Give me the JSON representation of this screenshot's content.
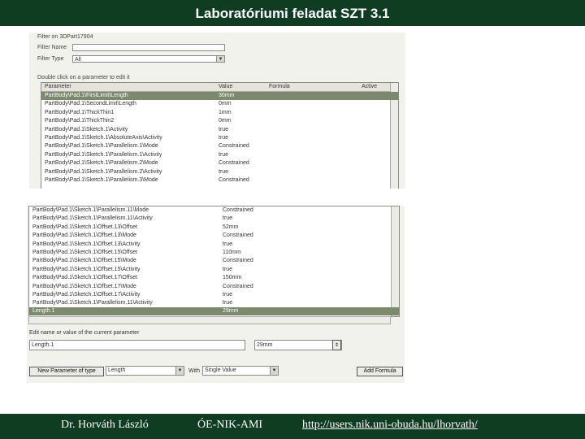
{
  "slide": {
    "title": "Laboratóriumi feladat SZT 3.1",
    "footer_author": "Dr. Horváth László",
    "footer_dept": "ÓE-NIK-AMI",
    "footer_url": "http://users.nik.uni-obuda.hu/lhorvath/"
  },
  "filters": {
    "filter_on_label": "Filter on 3DPart17904",
    "name_label": "Filter Name",
    "type_label": "Filter Type",
    "name_value": "",
    "type_value": "All"
  },
  "table": {
    "caption": "Double click on a parameter to edit it",
    "col_parameter": "Parameter",
    "col_value": "Value",
    "col_formula": "Formula",
    "col_active": "Active",
    "rows_top": [
      {
        "p": "PartBody\\Pad.1\\FirstLimit\\Length",
        "v": "30mm"
      },
      {
        "p": "PartBody\\Pad.1\\SecondLimit\\Length",
        "v": "0mm"
      },
      {
        "p": "PartBody\\Pad.1\\ThickThin1",
        "v": "1mm"
      },
      {
        "p": "PartBody\\Pad.1\\ThickThin2",
        "v": "0mm"
      },
      {
        "p": "PartBody\\Pad.1\\Sketch.1\\Activity",
        "v": "true"
      },
      {
        "p": "PartBody\\Pad.1\\Sketch.1\\AbsoluteAxis\\Activity",
        "v": "true"
      },
      {
        "p": "PartBody\\Pad.1\\Sketch.1\\Parallelism.1\\Mode",
        "v": "Constrained"
      },
      {
        "p": "PartBody\\Pad.1\\Sketch.1\\Parallelism.1\\Activity",
        "v": "true"
      },
      {
        "p": "PartBody\\Pad.1\\Sketch.1\\Parallelism.2\\Mode",
        "v": "Constrained"
      },
      {
        "p": "PartBody\\Pad.1\\Sketch.1\\Parallelism.2\\Activity",
        "v": "true"
      },
      {
        "p": "PartBody\\Pad.1\\Sketch.1\\Parallelism.3\\Mode",
        "v": "Constrained"
      }
    ],
    "rows_bottom": [
      {
        "p": "PartBody\\Pad.1\\Sketch.1\\Parallelism.11\\Mode",
        "v": "Constrained"
      },
      {
        "p": "PartBody\\Pad.1\\Sketch.1\\Parallelism.11\\Activity",
        "v": "true"
      },
      {
        "p": "PartBody\\Pad.1\\Sketch.1\\Offset.13\\Offset",
        "v": "52mm"
      },
      {
        "p": "PartBody\\Pad.1\\Sketch.1\\Offset.13\\Mode",
        "v": "Constrained"
      },
      {
        "p": "PartBody\\Pad.1\\Sketch.1\\Offset.13\\Activity",
        "v": "true"
      },
      {
        "p": "PartBody\\Pad.1\\Sketch.1\\Offset.15\\Offset",
        "v": "110mm"
      },
      {
        "p": "PartBody\\Pad.1\\Sketch.1\\Offset.15\\Mode",
        "v": "Constrained"
      },
      {
        "p": "PartBody\\Pad.1\\Sketch.1\\Offset.15\\Activity",
        "v": "true"
      },
      {
        "p": "PartBody\\Pad.1\\Sketch.1\\Offset.17\\Offset",
        "v": "150mm"
      },
      {
        "p": "PartBody\\Pad.1\\Sketch.1\\Offset.17\\Mode",
        "v": "Constrained"
      },
      {
        "p": "PartBody\\Pad.1\\Sketch.1\\Offset.17\\Activity",
        "v": "true"
      },
      {
        "p": "PartBody\\Pad.1\\Sketch.1\\Parallelism.11\\Activity",
        "v": "true"
      }
    ],
    "selected_row": {
      "p": "Length.1",
      "v": "29mm"
    }
  },
  "editor": {
    "label": "Edit name or value of the current parameter",
    "name_value": "Length.1",
    "value_value": "29mm",
    "new_param_button": "New Parameter of type",
    "type_value": "Length",
    "with_label": "With",
    "with_value": "Single Value",
    "add_formula_button": "Add Formula"
  }
}
